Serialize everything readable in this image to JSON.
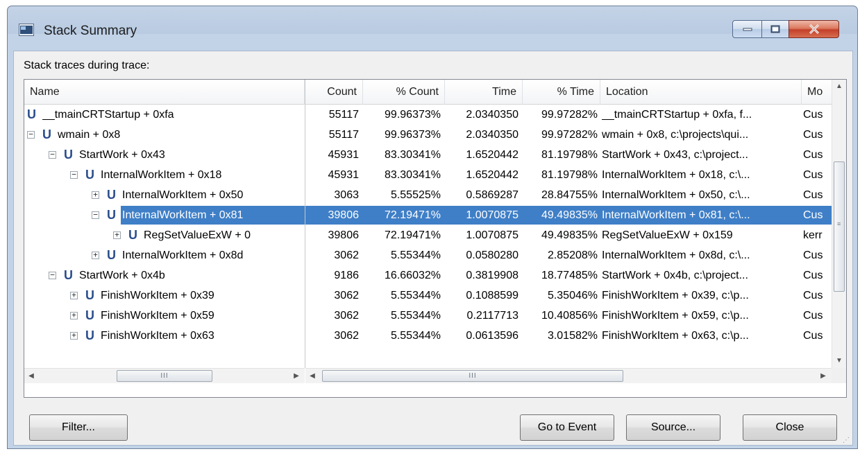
{
  "window": {
    "title": "Stack Summary",
    "accent_color": "#3f7fc7"
  },
  "section_label": "Stack traces during trace:",
  "columns": [
    "Name",
    "Count",
    "% Count",
    "Time",
    "% Time",
    "Location",
    "Mo"
  ],
  "rows": [
    {
      "name": "__tmainCRTStartup + 0xfa",
      "expander": "",
      "count": "55117",
      "pct_count": "99.96373%",
      "time": "2.0340350",
      "pct_time": "99.97282%",
      "location": "__tmainCRTStartup + 0xfa, f...",
      "module": "Cus"
    },
    {
      "name": "wmain + 0x8",
      "expander": "⊟",
      "count": "55117",
      "pct_count": "99.96373%",
      "time": "2.0340350",
      "pct_time": "99.97282%",
      "location": "wmain + 0x8, c:\\projects\\qui...",
      "module": "Cus"
    },
    {
      "name": "StartWork + 0x43",
      "expander": "⊟",
      "count": "45931",
      "pct_count": "83.30341%",
      "time": "1.6520442",
      "pct_time": "81.19798%",
      "location": "StartWork + 0x43, c:\\project...",
      "module": "Cus"
    },
    {
      "name": "InternalWorkItem + 0x18",
      "expander": "⊟",
      "count": "45931",
      "pct_count": "83.30341%",
      "time": "1.6520442",
      "pct_time": "81.19798%",
      "location": "InternalWorkItem + 0x18, c:\\...",
      "module": "Cus"
    },
    {
      "name": "InternalWorkItem + 0x50",
      "expander": "⊞",
      "count": "3063",
      "pct_count": "5.55525%",
      "time": "0.5869287",
      "pct_time": "28.84755%",
      "location": "InternalWorkItem + 0x50, c:\\...",
      "module": "Cus"
    },
    {
      "name": "InternalWorkItem + 0x81",
      "expander": "⊟",
      "count": "39806",
      "pct_count": "72.19471%",
      "time": "1.0070875",
      "pct_time": "49.49835%",
      "location": "InternalWorkItem + 0x81, c:\\...",
      "module": "Cus",
      "selected": true
    },
    {
      "name": "RegSetValueExW + 0",
      "expander": "⊞",
      "count": "39806",
      "pct_count": "72.19471%",
      "time": "1.0070875",
      "pct_time": "49.49835%",
      "location": "RegSetValueExW + 0x159",
      "module": "kerr"
    },
    {
      "name": "InternalWorkItem + 0x8d",
      "expander": "⊞",
      "count": "3062",
      "pct_count": "5.55344%",
      "time": "0.0580280",
      "pct_time": "2.85208%",
      "location": "InternalWorkItem + 0x8d, c:\\...",
      "module": "Cus"
    },
    {
      "name": "StartWork + 0x4b",
      "expander": "⊟",
      "count": "9186",
      "pct_count": "16.66032%",
      "time": "0.3819908",
      "pct_time": "18.77485%",
      "location": "StartWork + 0x4b, c:\\project...",
      "module": "Cus"
    },
    {
      "name": "FinishWorkItem + 0x39",
      "expander": "⊞",
      "count": "3062",
      "pct_count": "5.55344%",
      "time": "0.1088599",
      "pct_time": "5.35046%",
      "location": "FinishWorkItem + 0x39, c:\\p...",
      "module": "Cus"
    },
    {
      "name": "FinishWorkItem + 0x59",
      "expander": "⊞",
      "count": "3062",
      "pct_count": "5.55344%",
      "time": "0.2117713",
      "pct_time": "10.40856%",
      "location": "FinishWorkItem + 0x59, c:\\p...",
      "module": "Cus"
    },
    {
      "name": "FinishWorkItem + 0x63",
      "expander": "⊞",
      "count": "3062",
      "pct_count": "5.55344%",
      "time": "0.0613596",
      "pct_time": "3.01582%",
      "location": "FinishWorkItem + 0x63, c:\\p...",
      "module": "Cus"
    }
  ],
  "tree_glyph": "U",
  "scroll_grip": "III",
  "buttons": {
    "filter": "Filter...",
    "go_to_event": "Go to Event",
    "source": "Source...",
    "close": "Close"
  }
}
